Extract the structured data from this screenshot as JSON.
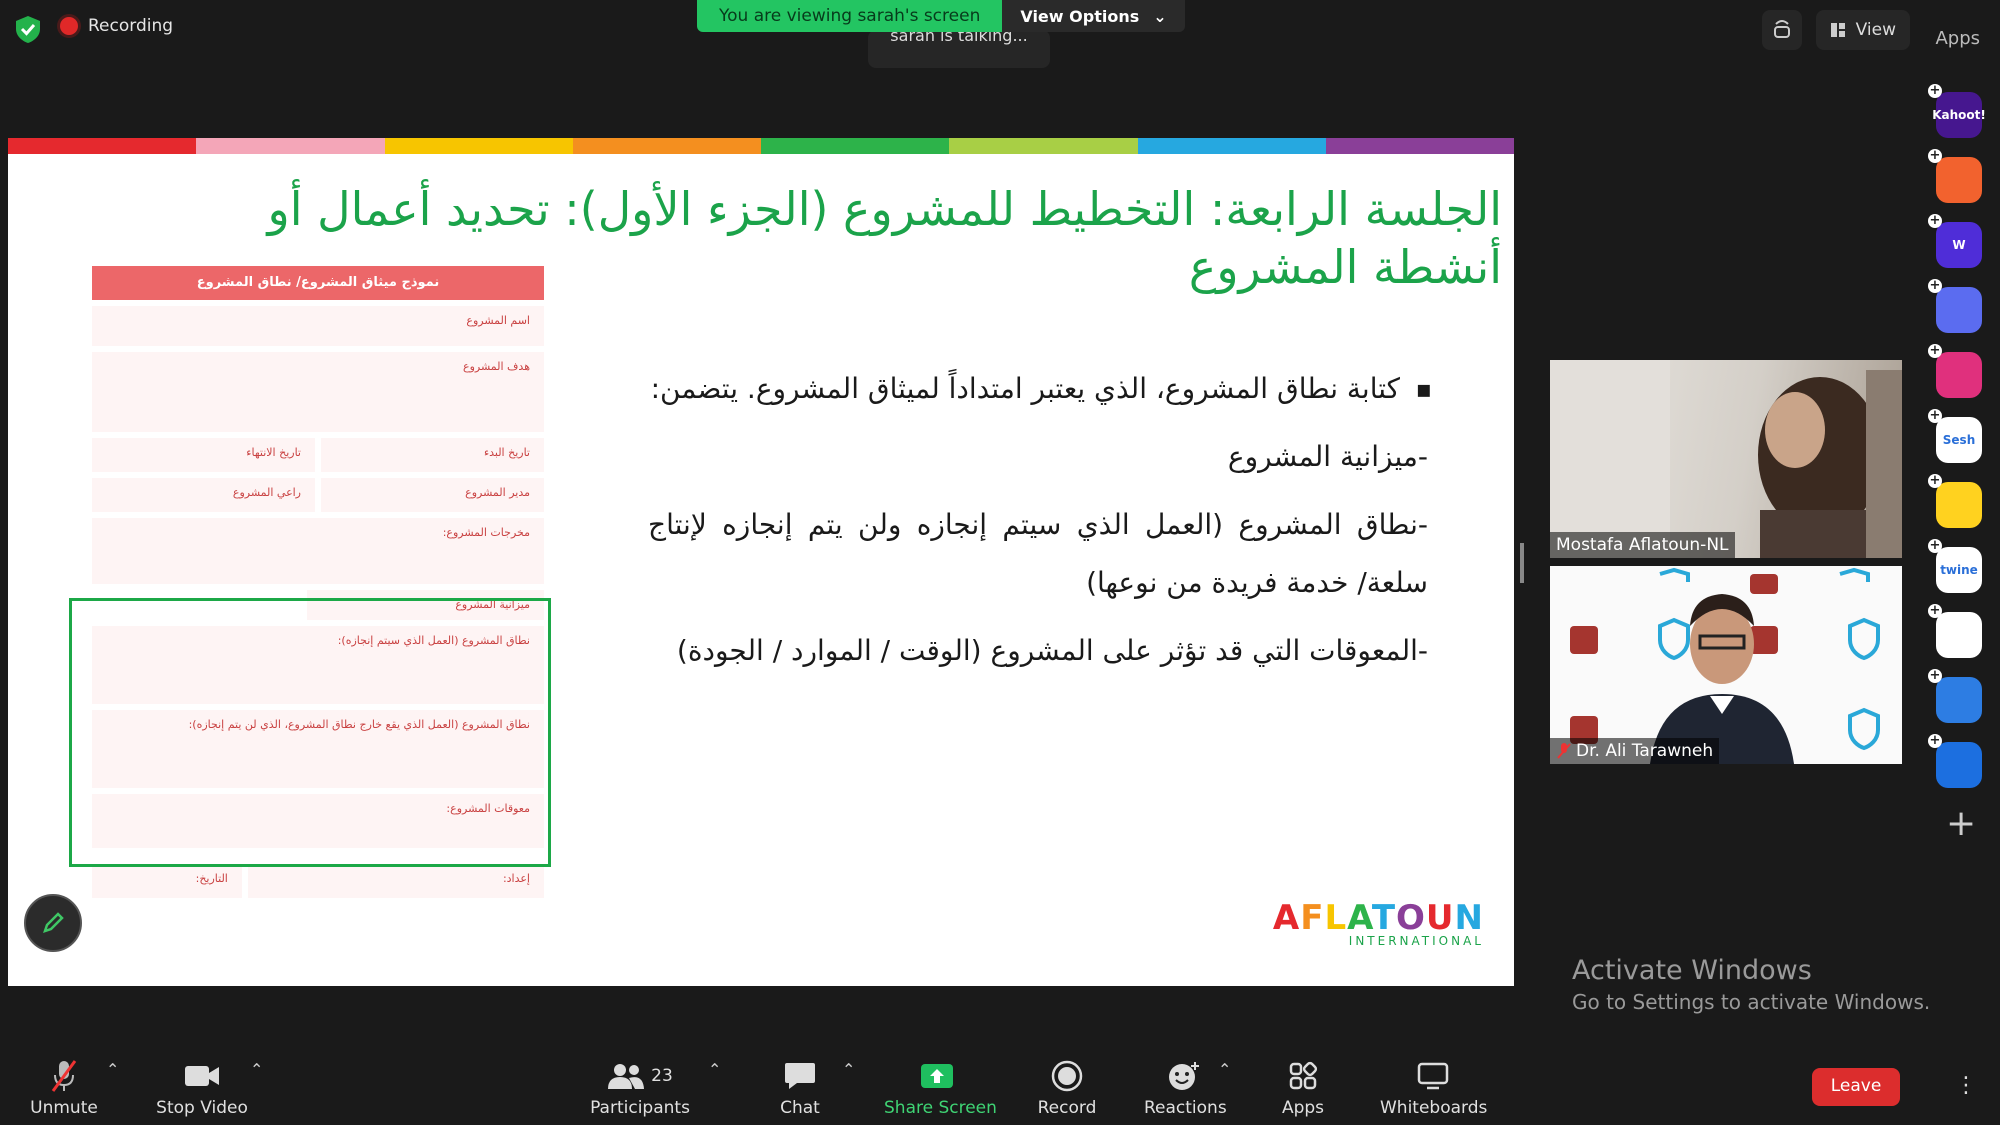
{
  "top": {
    "recording_label": "Recording",
    "share_banner": "You are viewing sarah's screen",
    "view_options_label": "View Options",
    "talking_text": "sarah is talking...",
    "view_label": "View",
    "apps_label": "Apps"
  },
  "slide": {
    "title": "الجلسة الرابعة: التخطيط للمشروع (الجزء الأول): تحديد أعمال أو أنشطة المشروع",
    "bullet_main": "كتابة نطاق المشروع، الذي يعتبر امتداداً لميثاق المشروع. يتضمن:",
    "item1": "-ميزانية المشروع",
    "item2": "-نطاق المشروع (العمل الذي سيتم إنجازه ولن يتم إنجازه لإنتاج سلعة/ خدمة فريدة من نوعها)",
    "item3": "-المعوقات التي قد تؤثر على المشروع (الوقت / الموارد / الجودة)",
    "stripe_colors": [
      "#e5292e",
      "#f4a6b8",
      "#f7c500",
      "#f48f1f",
      "#2db34a",
      "#a8cf45",
      "#26a8e0",
      "#8a3f98"
    ],
    "logo_text": "AFLATOUN",
    "logo_sub": "INTERNATIONAL",
    "form": {
      "header": "نموذج ميثاق المشروع/ نطاق المشروع",
      "project_name": "اسم المشروع",
      "project_goal": "هدف المشروع",
      "start_date": "تاريخ البدء",
      "end_date": "تاريخ الانتهاء",
      "manager": "مدير المشروع",
      "sponsor": "راعي المشروع",
      "outputs": "مخرجات المشروع:",
      "budget": "ميزانية المشروع",
      "scope_in": "نطاق المشروع (العمل الذي سيتم إنجازه):",
      "scope_out": "نطاق المشروع (العمل الذي يقع خارج نطاق المشروع، الذي لن يتم إنجازه):",
      "constraints": "معوقات المشروع:",
      "prepared_by": "إعداد:",
      "date": "التاريخ:"
    }
  },
  "videos": [
    {
      "name": "Mostafa Aflatoun-NL"
    },
    {
      "name": "Dr. Ali Tarawneh"
    }
  ],
  "sidebar_apps": [
    {
      "label": "Kahoot!",
      "color": "#46178f"
    },
    {
      "label": "",
      "color": "#f2622e"
    },
    {
      "label": "W",
      "color": "#4f2dd8"
    },
    {
      "label": "",
      "color": "#5b6cf0"
    },
    {
      "label": "",
      "color": "#e0307d"
    },
    {
      "label": "Sesh",
      "color": "#ffffff"
    },
    {
      "label": "",
      "color": "#ffd21f"
    },
    {
      "label": "twine",
      "color": "#ffffff"
    },
    {
      "label": "",
      "color": "#ffffff"
    },
    {
      "label": "",
      "color": "#2d7de3"
    },
    {
      "label": "",
      "color": "#1c6fe0"
    }
  ],
  "watermark": {
    "line1": "Activate Windows",
    "line2": "Go to Settings to activate Windows."
  },
  "toolbar": {
    "unmute": "Unmute",
    "stop_video": "Stop Video",
    "participants": "Participants",
    "participants_count": "23",
    "chat": "Chat",
    "share_screen": "Share Screen",
    "record": "Record",
    "reactions": "Reactions",
    "apps": "Apps",
    "whiteboards": "Whiteboards",
    "leave": "Leave"
  }
}
